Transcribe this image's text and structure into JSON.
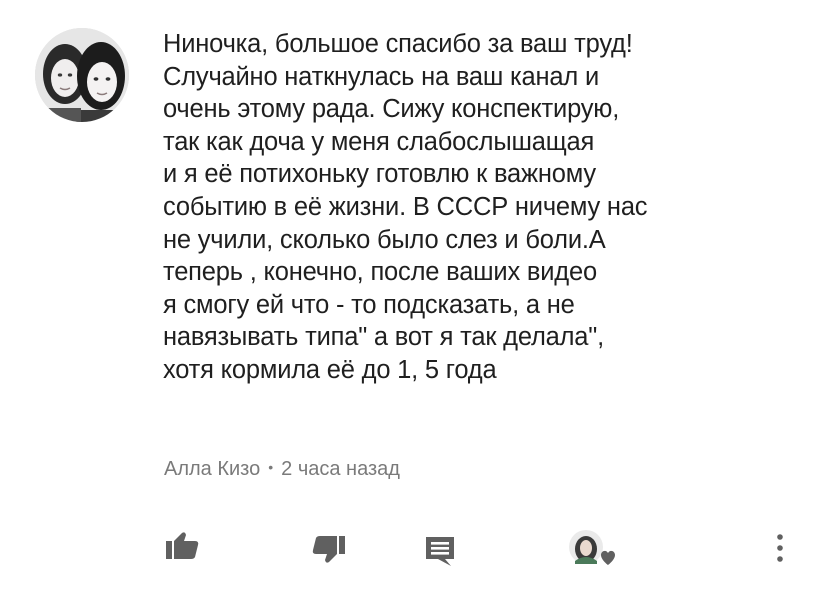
{
  "comment": {
    "text_lines": [
      "Ниночка, большое спасибо за ваш труд!",
      "Случайно наткнулась на ваш канал и",
      "очень этому рада. Сижу конспектирую,",
      "так как доча у меня слабослышащая",
      "и я её потихоньку готовлю к важному",
      "событию в её жизни. В СССР ничему нас",
      "не учили, сколько было слез и боли.А",
      "теперь , конечно, после ваших видео",
      "я смогу ей что - то подсказать, а не",
      "навязывать типа\" а вот я так делала\",",
      "хотя кормила её до 1, 5 года"
    ],
    "author": "Алла Кизо",
    "separator": "•",
    "time": "2 часа назад"
  },
  "actions": {
    "like_icon": "thumbs-up-icon",
    "dislike_icon": "thumbs-down-icon",
    "reply_icon": "reply-icon",
    "creator_heart_icon": "creator-heart-icon",
    "more_icon": "more-vertical-icon"
  },
  "colors": {
    "text": "#1f1f1f",
    "meta": "#7a7a7a",
    "icon": "#606060",
    "heart": "#606060"
  }
}
